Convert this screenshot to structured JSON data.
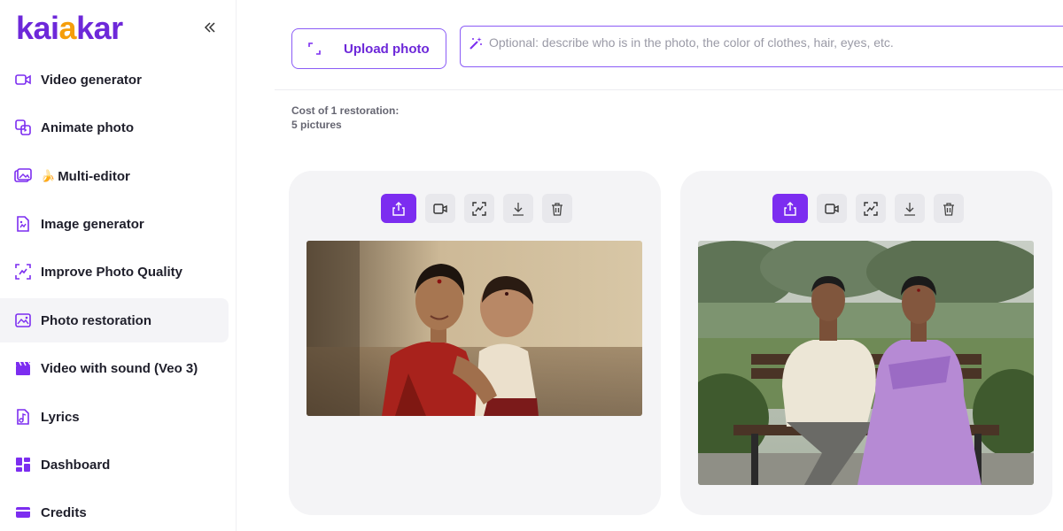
{
  "brand": {
    "logo_part1": "kai",
    "logo_part2": "a",
    "logo_part3": "kar"
  },
  "sidebar": {
    "items": [
      {
        "label": "Video generator",
        "icon": "video-icon"
      },
      {
        "label": "Animate photo",
        "icon": "animate-icon"
      },
      {
        "label": "Multi-editor",
        "icon": "multi-editor-icon"
      },
      {
        "label": "Image generator",
        "icon": "image-file-icon"
      },
      {
        "label": "Improve Photo Quality",
        "icon": "enhance-icon"
      },
      {
        "label": "Photo restoration",
        "icon": "restore-icon",
        "active": true
      },
      {
        "label": "Video with sound (Veo 3)",
        "icon": "clapperboard-icon"
      },
      {
        "label": "Lyrics",
        "icon": "lyrics-icon"
      },
      {
        "label": "Dashboard",
        "icon": "dashboard-icon"
      },
      {
        "label": "Credits",
        "icon": "card-icon"
      }
    ]
  },
  "upload": {
    "label": "Upload photo"
  },
  "prompt": {
    "placeholder": "Optional: describe who is in the photo, the color of clothes, hair, eyes, etc."
  },
  "cost": {
    "line1": "Cost of 1 restoration:",
    "line2": "5 pictures"
  },
  "cards": [
    {
      "toolbar": [
        "share-icon",
        "video-convert-icon",
        "enhance-icon",
        "download-icon",
        "trash-icon"
      ]
    },
    {
      "toolbar": [
        "share-icon",
        "video-convert-icon",
        "enhance-icon",
        "download-icon",
        "trash-icon"
      ]
    }
  ],
  "colors": {
    "accent": "#7c2df0",
    "logo_purple": "#6d28d9",
    "logo_orange": "#f59e0b"
  }
}
